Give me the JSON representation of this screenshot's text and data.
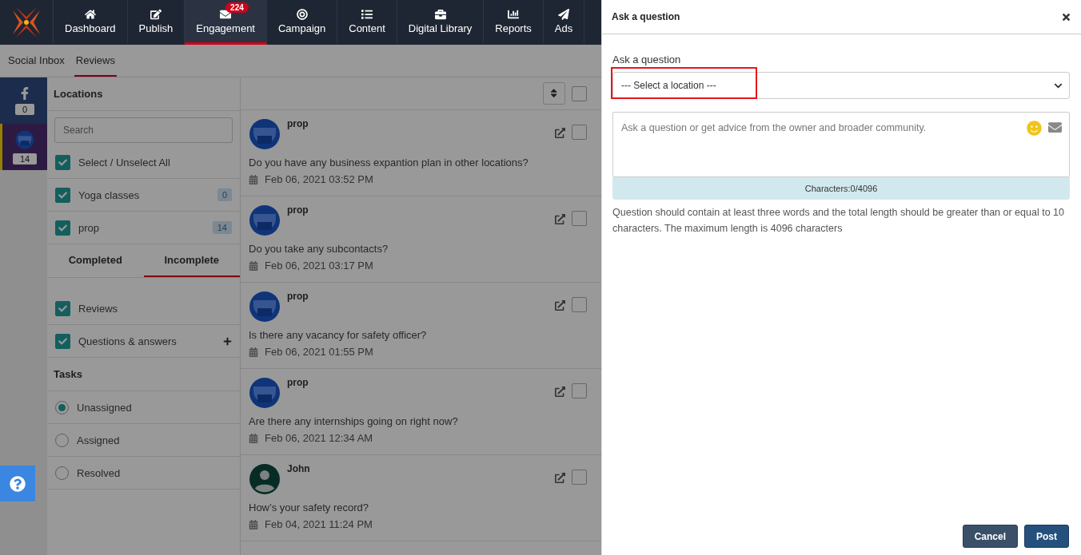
{
  "nav": [
    {
      "label": "Dashboard",
      "selected": false
    },
    {
      "label": "Publish",
      "selected": false
    },
    {
      "label": "Engagement",
      "selected": true,
      "badge": "224"
    },
    {
      "label": "Campaign",
      "selected": false
    },
    {
      "label": "Content",
      "selected": false
    },
    {
      "label": "Digital Library",
      "selected": false
    },
    {
      "label": "Reports",
      "selected": false
    },
    {
      "label": "Ads",
      "selected": false
    }
  ],
  "list_header": {
    "checked": false
  },
  "subnav": [
    {
      "label": "Social Inbox",
      "selected": false
    },
    {
      "label": "Reviews",
      "selected": true
    }
  ],
  "channels": [
    {
      "kind": "facebook",
      "count": "0",
      "selected": false
    },
    {
      "kind": "store",
      "count": "14",
      "selected": true
    }
  ],
  "filters": {
    "locations_title": "Locations",
    "search_placeholder": "Search",
    "select_all": {
      "label": "Select / Unselect All",
      "checked": true
    },
    "locations": [
      {
        "name": "Yoga classes",
        "count": "0",
        "checked": true
      },
      {
        "name": "prop",
        "count": "14",
        "checked": true
      }
    ],
    "tabs": [
      {
        "label": "Completed",
        "selected": false
      },
      {
        "label": "Incomplete",
        "selected": true
      }
    ],
    "types": [
      {
        "label": "Reviews",
        "checked": true,
        "addable": false
      },
      {
        "label": "Questions & answers",
        "checked": true,
        "addable": true
      }
    ],
    "tasks_title": "Tasks",
    "tasks": [
      {
        "label": "Unassigned",
        "selected": true
      },
      {
        "label": "Assigned",
        "selected": false
      },
      {
        "label": "Resolved",
        "selected": false
      }
    ]
  },
  "messages": [
    {
      "author": "prop",
      "kind": "store",
      "text": "Do you have any business expantion plan in other locations?",
      "date": "Feb 06, 2021 03:52 PM",
      "checked": false
    },
    {
      "author": "prop",
      "kind": "store",
      "text": "Do you take any subcontacts?",
      "date": "Feb 06, 2021 03:17 PM",
      "checked": false
    },
    {
      "author": "prop",
      "kind": "store",
      "text": "Is there any vacancy for safety officer?",
      "date": "Feb 06, 2021 01:55 PM",
      "checked": false
    },
    {
      "author": "prop",
      "kind": "store",
      "text": "Are there any internships going on right now?",
      "date": "Feb 06, 2021 12:34 AM",
      "checked": false
    },
    {
      "author": "John",
      "kind": "person",
      "text": "How’s your safety record?",
      "date": "Feb 04, 2021 11:24 PM",
      "checked": false
    }
  ],
  "dialog": {
    "title": "Ask a question",
    "label": "Ask a question",
    "location_placeholder": "--- Select a location ---",
    "location_highlighted": true,
    "question_placeholder": "Ask a question or get advice from the owner and broader community.",
    "counter": "Characters:0/4096",
    "hint": "Question should contain at least three words and the total length should be greater than or equal to 10 characters. The maximum length is 4096 characters",
    "buttons": [
      {
        "label": "Cancel",
        "kind": "secondary"
      },
      {
        "label": "Post",
        "kind": "primary"
      }
    ]
  }
}
